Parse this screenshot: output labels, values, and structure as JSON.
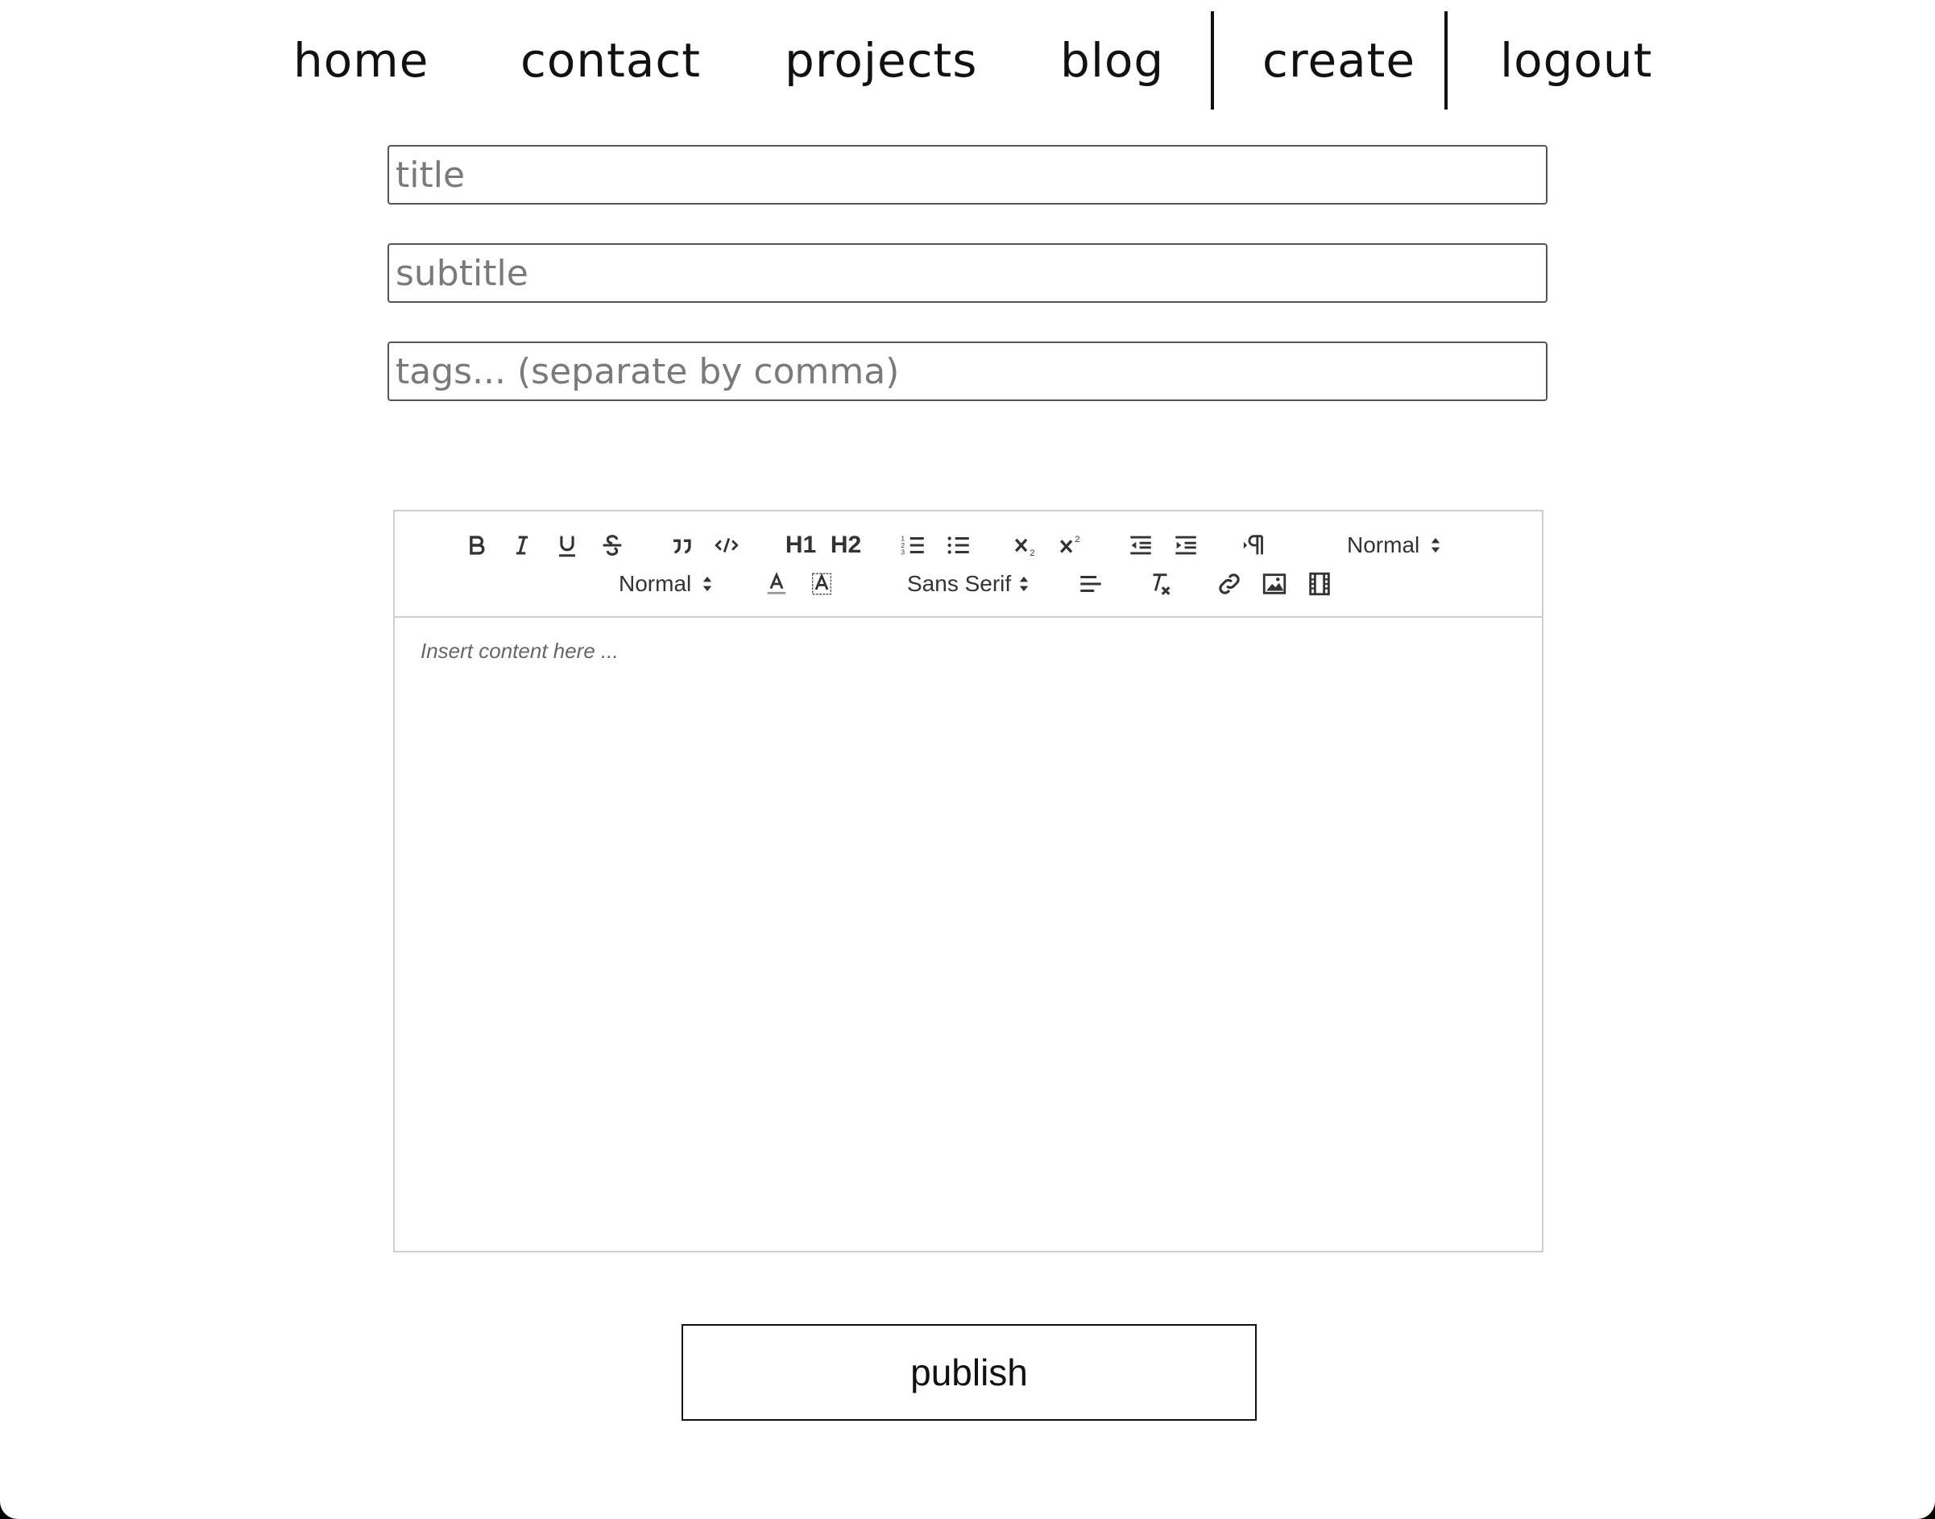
{
  "nav": {
    "links": [
      "home",
      "contact",
      "projects",
      "blog",
      "create",
      "logout"
    ]
  },
  "form": {
    "title_placeholder": "title",
    "subtitle_placeholder": "subtitle",
    "tags_placeholder": "tags... (separate by comma)"
  },
  "editor": {
    "toolbar": {
      "buttons_row1": [
        "bold-icon",
        "italic-icon",
        "underline-icon",
        "strikethrough-icon",
        "blockquote-icon",
        "code-block-icon",
        "header-1",
        "header-2",
        "ordered-list-icon",
        "bullet-list-icon",
        "subscript-icon",
        "superscript-icon",
        "outdent-icon",
        "indent-icon",
        "text-direction-icon"
      ],
      "header1_label": "H1",
      "header2_label": "H2",
      "header_select": "Normal",
      "size_select": "Normal",
      "font_select": "Sans Serif",
      "buttons_row2": [
        "text-color-icon",
        "background-color-icon",
        "align-left-icon",
        "clear-format-icon",
        "link-icon",
        "image-icon",
        "video-icon"
      ]
    },
    "content_placeholder": "Insert content here ..."
  },
  "publish_label": "publish",
  "colors": {
    "background": "#ffffff",
    "text": "#111111",
    "placeholder": "#7a7a7a",
    "editor_border": "#cfcfcf"
  }
}
